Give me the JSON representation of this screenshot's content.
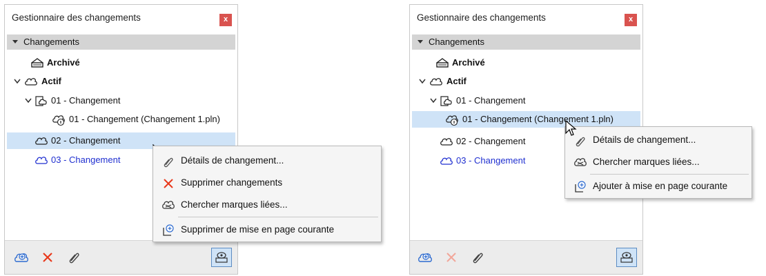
{
  "left_panel": {
    "title": "Gestionnaire des changements",
    "close_label": "x",
    "section_label": "Changements",
    "tree": {
      "archived": "Archivé",
      "active": "Actif",
      "change01": "01 - Changement",
      "change01_file": "01 - Changement (Changement 1.pln)",
      "change02": "02 - Changement",
      "change03": "03 - Changement"
    },
    "context_menu": {
      "details": "Détails de changement...",
      "delete": "Supprimer changements",
      "find": "Chercher marques liées...",
      "remove_layout": "Supprimer de mise en page courante"
    }
  },
  "right_panel": {
    "title": "Gestionnaire des changements",
    "close_label": "x",
    "section_label": "Changements",
    "tree": {
      "archived": "Archivé",
      "active": "Actif",
      "change01": "01 - Changement",
      "change01_file": "01 - Changement (Changement 1.pln)",
      "change02": "02 - Changement",
      "change03": "03 - Changement"
    },
    "context_menu": {
      "details": "Détails de changement...",
      "find": "Chercher marques liées...",
      "add_layout": "Ajouter à mise en page courante"
    }
  },
  "colors": {
    "selection": "#cfe3f7",
    "section_header": "#d4d4d4",
    "close_button": "#d9534f",
    "blue_text": "#1f2fd0",
    "delete_red": "#e8391c"
  },
  "icons": [
    "archive-icon",
    "cloud-icon",
    "cloud-doc-icon",
    "cloud-info-icon",
    "new-change-icon",
    "delete-icon",
    "paperclip-icon",
    "view-toggle-icon",
    "search-marks-icon",
    "layout-icon",
    "cursor-icon"
  ]
}
